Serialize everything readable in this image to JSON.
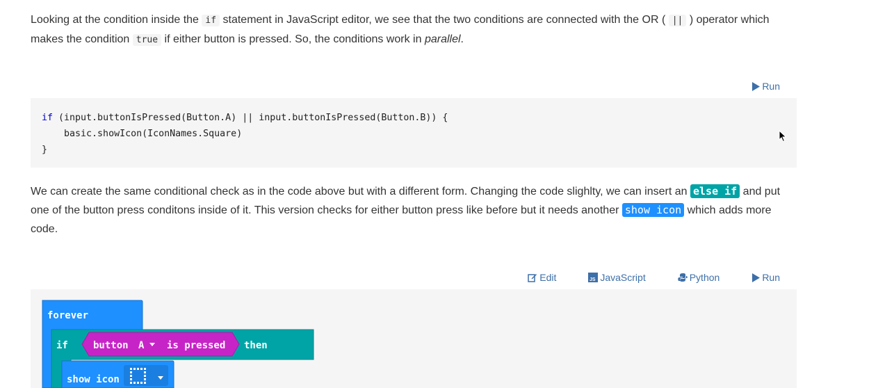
{
  "para1": {
    "t1": "Looking at the condition inside the ",
    "code1": "if",
    "t2": " statement in JavaScript editor, we see that the two conditions are connected with the OR ( ",
    "code2": "||",
    "t3": " ) operator which makes the condition ",
    "code3": "true",
    "t4": " if either button is pressed. So, the conditions work in ",
    "em": "parallel",
    "t5": "."
  },
  "code_toolbar": {
    "run": "Run"
  },
  "code_lines": [
    "if (input.buttonIsPressed(Button.A) || input.buttonIsPressed(Button.B)) {",
    "    basic.showIcon(IconNames.Square)",
    "}"
  ],
  "para2": {
    "t1": "We can create the same conditional check as in the code above but with a different form. Changing the code slighlty, we can insert an ",
    "tag1": "else if",
    "t2": " and put one of the button press conditons inside of it. This version checks for either button press like before but it needs another ",
    "tag2": "show icon",
    "t3": " which adds more code."
  },
  "block_toolbar": {
    "edit": "Edit",
    "javascript": "JavaScript",
    "python": "Python",
    "run": "Run"
  },
  "blocks": {
    "forever": "forever",
    "if": "if",
    "button": "button",
    "button_value": "A",
    "is_pressed": "is pressed",
    "then": "then",
    "show_icon": "show icon"
  },
  "colors": {
    "link": "#3d6fa8",
    "forever": "#1e90ff",
    "logic": "#00a4a6",
    "input": "#c724c7",
    "basic": "#1e90ff"
  }
}
